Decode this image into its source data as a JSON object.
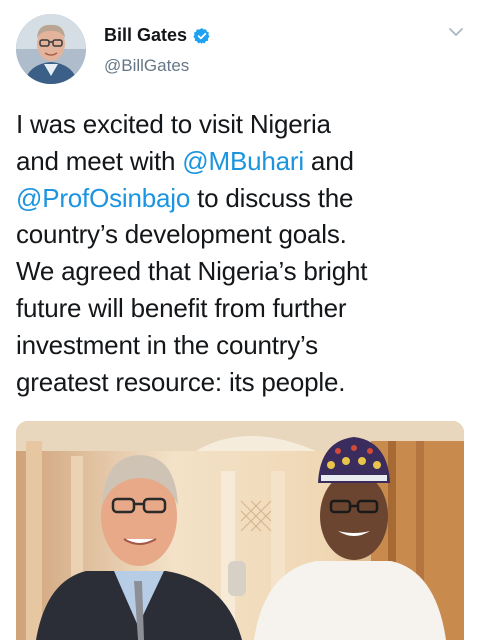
{
  "user": {
    "name": "Bill Gates",
    "handle": "@BillGates",
    "verified": true,
    "avatar_icon": "avatar-photo"
  },
  "menu_icon": "chevron-down-icon",
  "tweet": {
    "lines": [
      [
        {
          "t": "I was excited to visit Nigeria"
        }
      ],
      [
        {
          "t": "and meet with "
        },
        {
          "t": "@MBuhari",
          "m": true
        },
        {
          "t": " and"
        }
      ],
      [
        {
          "t": "@ProfOsinbajo",
          "m": true
        },
        {
          "t": " to discuss the"
        }
      ],
      [
        {
          "t": "country’s development goals."
        }
      ],
      [
        {
          "t": "We agreed that Nigeria’s bright"
        }
      ],
      [
        {
          "t": "future will benefit from further"
        }
      ],
      [
        {
          "t": "investment in the country’s"
        }
      ],
      [
        {
          "t": "greatest resource: its people."
        }
      ]
    ]
  },
  "colors": {
    "text": "#14171a",
    "secondary": "#657786",
    "mention": "#1b95e0",
    "verified": "#1da1f2"
  }
}
